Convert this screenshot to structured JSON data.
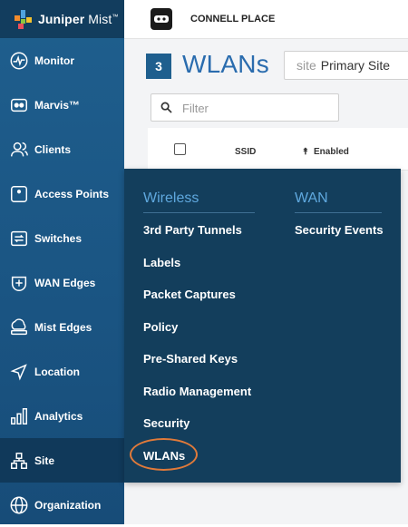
{
  "app": {
    "logo_brand": "Juniper",
    "logo_product": "Mist",
    "logo_tm": "™"
  },
  "sidebar": {
    "items": [
      {
        "label": "Monitor",
        "icon": "monitor-icon"
      },
      {
        "label": "Marvis™",
        "icon": "marvis-icon"
      },
      {
        "label": "Clients",
        "icon": "clients-icon"
      },
      {
        "label": "Access Points",
        "icon": "access-point-icon"
      },
      {
        "label": "Switches",
        "icon": "switch-icon"
      },
      {
        "label": "WAN Edges",
        "icon": "wan-edge-icon"
      },
      {
        "label": "Mist Edges",
        "icon": "mist-edge-icon"
      },
      {
        "label": "Location",
        "icon": "location-icon"
      },
      {
        "label": "Analytics",
        "icon": "analytics-icon"
      },
      {
        "label": "Site",
        "icon": "site-icon",
        "active": true
      },
      {
        "label": "Organization",
        "icon": "organization-icon"
      }
    ]
  },
  "topbar": {
    "site_name": "CONNELL PLACE"
  },
  "main": {
    "count": "3",
    "title": "WLANs",
    "site_select": {
      "label": "site",
      "value": "Primary Site"
    },
    "filter_placeholder": "Filter",
    "columns": {
      "ssid": "SSID",
      "enabled": "Enabled"
    }
  },
  "flyout": {
    "wireless": {
      "heading": "Wireless",
      "items": [
        "3rd Party Tunnels",
        "Labels",
        "Packet Captures",
        "Policy",
        "Pre-Shared Keys",
        "Radio Management",
        "Security",
        "WLANs"
      ]
    },
    "wan": {
      "heading": "WAN",
      "items": [
        "Security Events"
      ]
    },
    "highlighted_item": "WLANs"
  },
  "colors": {
    "sidebar_bg": "#1a5482",
    "flyout_bg": "#133e5c",
    "accent_blue": "#2a6cae",
    "flyout_heading": "#5fa8de",
    "highlight_ring": "#e07a3a"
  }
}
